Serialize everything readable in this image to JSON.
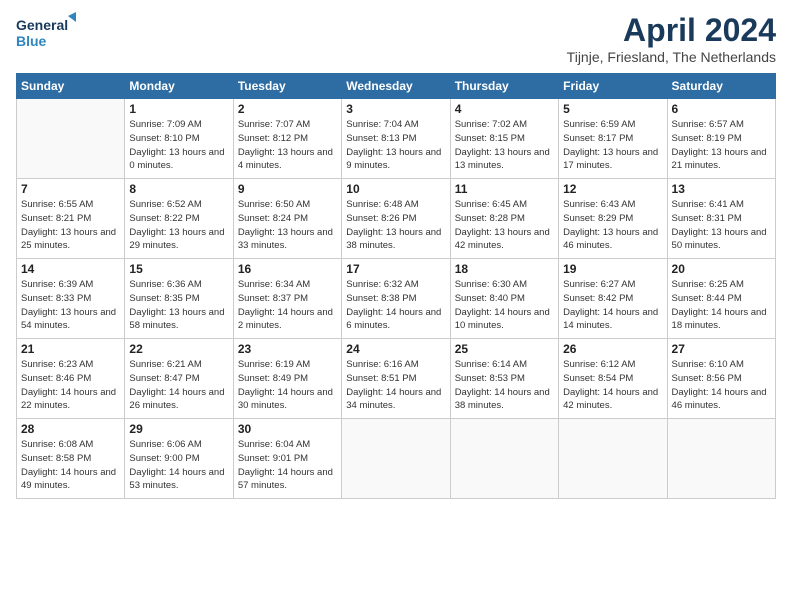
{
  "logo": {
    "line1": "General",
    "line2": "Blue"
  },
  "title": "April 2024",
  "location": "Tijnje, Friesland, The Netherlands",
  "weekdays": [
    "Sunday",
    "Monday",
    "Tuesday",
    "Wednesday",
    "Thursday",
    "Friday",
    "Saturday"
  ],
  "weeks": [
    [
      {
        "day": "",
        "sunrise": "",
        "sunset": "",
        "daylight": ""
      },
      {
        "day": "1",
        "sunrise": "Sunrise: 7:09 AM",
        "sunset": "Sunset: 8:10 PM",
        "daylight": "Daylight: 13 hours and 0 minutes."
      },
      {
        "day": "2",
        "sunrise": "Sunrise: 7:07 AM",
        "sunset": "Sunset: 8:12 PM",
        "daylight": "Daylight: 13 hours and 4 minutes."
      },
      {
        "day": "3",
        "sunrise": "Sunrise: 7:04 AM",
        "sunset": "Sunset: 8:13 PM",
        "daylight": "Daylight: 13 hours and 9 minutes."
      },
      {
        "day": "4",
        "sunrise": "Sunrise: 7:02 AM",
        "sunset": "Sunset: 8:15 PM",
        "daylight": "Daylight: 13 hours and 13 minutes."
      },
      {
        "day": "5",
        "sunrise": "Sunrise: 6:59 AM",
        "sunset": "Sunset: 8:17 PM",
        "daylight": "Daylight: 13 hours and 17 minutes."
      },
      {
        "day": "6",
        "sunrise": "Sunrise: 6:57 AM",
        "sunset": "Sunset: 8:19 PM",
        "daylight": "Daylight: 13 hours and 21 minutes."
      }
    ],
    [
      {
        "day": "7",
        "sunrise": "Sunrise: 6:55 AM",
        "sunset": "Sunset: 8:21 PM",
        "daylight": "Daylight: 13 hours and 25 minutes."
      },
      {
        "day": "8",
        "sunrise": "Sunrise: 6:52 AM",
        "sunset": "Sunset: 8:22 PM",
        "daylight": "Daylight: 13 hours and 29 minutes."
      },
      {
        "day": "9",
        "sunrise": "Sunrise: 6:50 AM",
        "sunset": "Sunset: 8:24 PM",
        "daylight": "Daylight: 13 hours and 33 minutes."
      },
      {
        "day": "10",
        "sunrise": "Sunrise: 6:48 AM",
        "sunset": "Sunset: 8:26 PM",
        "daylight": "Daylight: 13 hours and 38 minutes."
      },
      {
        "day": "11",
        "sunrise": "Sunrise: 6:45 AM",
        "sunset": "Sunset: 8:28 PM",
        "daylight": "Daylight: 13 hours and 42 minutes."
      },
      {
        "day": "12",
        "sunrise": "Sunrise: 6:43 AM",
        "sunset": "Sunset: 8:29 PM",
        "daylight": "Daylight: 13 hours and 46 minutes."
      },
      {
        "day": "13",
        "sunrise": "Sunrise: 6:41 AM",
        "sunset": "Sunset: 8:31 PM",
        "daylight": "Daylight: 13 hours and 50 minutes."
      }
    ],
    [
      {
        "day": "14",
        "sunrise": "Sunrise: 6:39 AM",
        "sunset": "Sunset: 8:33 PM",
        "daylight": "Daylight: 13 hours and 54 minutes."
      },
      {
        "day": "15",
        "sunrise": "Sunrise: 6:36 AM",
        "sunset": "Sunset: 8:35 PM",
        "daylight": "Daylight: 13 hours and 58 minutes."
      },
      {
        "day": "16",
        "sunrise": "Sunrise: 6:34 AM",
        "sunset": "Sunset: 8:37 PM",
        "daylight": "Daylight: 14 hours and 2 minutes."
      },
      {
        "day": "17",
        "sunrise": "Sunrise: 6:32 AM",
        "sunset": "Sunset: 8:38 PM",
        "daylight": "Daylight: 14 hours and 6 minutes."
      },
      {
        "day": "18",
        "sunrise": "Sunrise: 6:30 AM",
        "sunset": "Sunset: 8:40 PM",
        "daylight": "Daylight: 14 hours and 10 minutes."
      },
      {
        "day": "19",
        "sunrise": "Sunrise: 6:27 AM",
        "sunset": "Sunset: 8:42 PM",
        "daylight": "Daylight: 14 hours and 14 minutes."
      },
      {
        "day": "20",
        "sunrise": "Sunrise: 6:25 AM",
        "sunset": "Sunset: 8:44 PM",
        "daylight": "Daylight: 14 hours and 18 minutes."
      }
    ],
    [
      {
        "day": "21",
        "sunrise": "Sunrise: 6:23 AM",
        "sunset": "Sunset: 8:46 PM",
        "daylight": "Daylight: 14 hours and 22 minutes."
      },
      {
        "day": "22",
        "sunrise": "Sunrise: 6:21 AM",
        "sunset": "Sunset: 8:47 PM",
        "daylight": "Daylight: 14 hours and 26 minutes."
      },
      {
        "day": "23",
        "sunrise": "Sunrise: 6:19 AM",
        "sunset": "Sunset: 8:49 PM",
        "daylight": "Daylight: 14 hours and 30 minutes."
      },
      {
        "day": "24",
        "sunrise": "Sunrise: 6:16 AM",
        "sunset": "Sunset: 8:51 PM",
        "daylight": "Daylight: 14 hours and 34 minutes."
      },
      {
        "day": "25",
        "sunrise": "Sunrise: 6:14 AM",
        "sunset": "Sunset: 8:53 PM",
        "daylight": "Daylight: 14 hours and 38 minutes."
      },
      {
        "day": "26",
        "sunrise": "Sunrise: 6:12 AM",
        "sunset": "Sunset: 8:54 PM",
        "daylight": "Daylight: 14 hours and 42 minutes."
      },
      {
        "day": "27",
        "sunrise": "Sunrise: 6:10 AM",
        "sunset": "Sunset: 8:56 PM",
        "daylight": "Daylight: 14 hours and 46 minutes."
      }
    ],
    [
      {
        "day": "28",
        "sunrise": "Sunrise: 6:08 AM",
        "sunset": "Sunset: 8:58 PM",
        "daylight": "Daylight: 14 hours and 49 minutes."
      },
      {
        "day": "29",
        "sunrise": "Sunrise: 6:06 AM",
        "sunset": "Sunset: 9:00 PM",
        "daylight": "Daylight: 14 hours and 53 minutes."
      },
      {
        "day": "30",
        "sunrise": "Sunrise: 6:04 AM",
        "sunset": "Sunset: 9:01 PM",
        "daylight": "Daylight: 14 hours and 57 minutes."
      },
      {
        "day": "",
        "sunrise": "",
        "sunset": "",
        "daylight": ""
      },
      {
        "day": "",
        "sunrise": "",
        "sunset": "",
        "daylight": ""
      },
      {
        "day": "",
        "sunrise": "",
        "sunset": "",
        "daylight": ""
      },
      {
        "day": "",
        "sunrise": "",
        "sunset": "",
        "daylight": ""
      }
    ]
  ]
}
